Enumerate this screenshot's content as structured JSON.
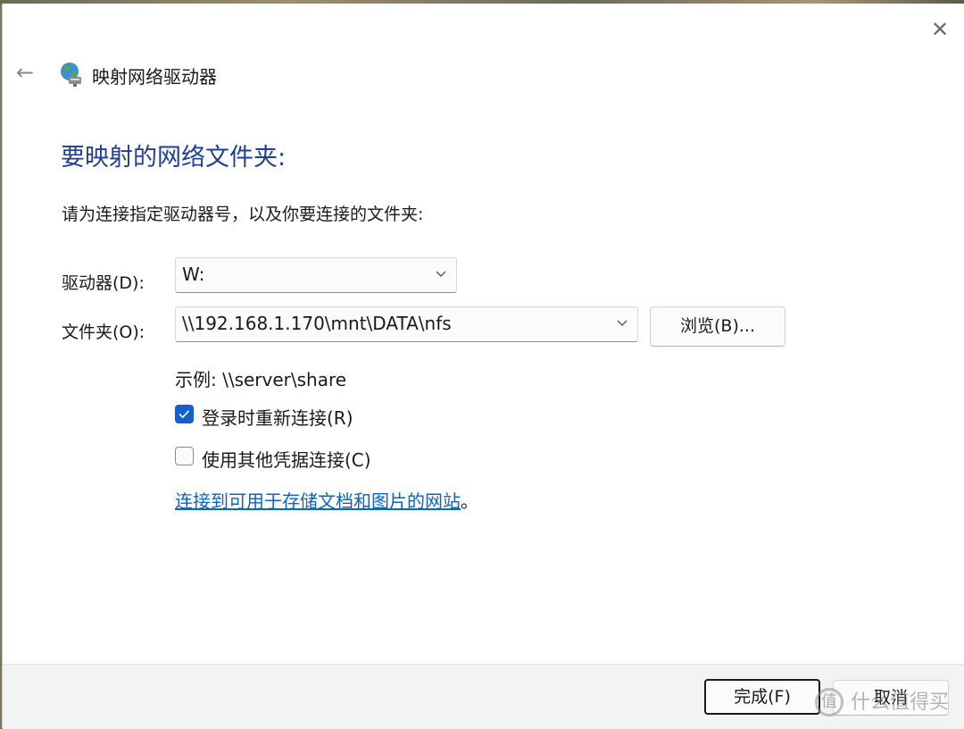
{
  "window": {
    "title": "映射网络驱动器",
    "close_glyph": "✕",
    "back_glyph": "←"
  },
  "main": {
    "heading": "要映射的网络文件夹:",
    "description": "请为连接指定驱动器号，以及你要连接的文件夹:",
    "drive": {
      "label": "驱动器(D):",
      "value": "W:"
    },
    "folder": {
      "label": "文件夹(O):",
      "value": "\\\\192.168.1.170\\mnt\\DATA\\nfs"
    },
    "browse_label": "浏览(B)...",
    "example": "示例: \\\\server\\share",
    "reconnect": {
      "label": "登录时重新连接(R)",
      "checked": true
    },
    "other_credentials": {
      "label": "使用其他凭据连接(C)",
      "checked": false
    },
    "link": {
      "text": "连接到可用于存储文档和图片的网站",
      "suffix": "。"
    }
  },
  "footer": {
    "finish_label": "完成(F)",
    "cancel_label": "取消"
  },
  "watermark": {
    "glyph": "值",
    "text": "什么值得买"
  },
  "colors": {
    "heading": "#1f3f94",
    "accent": "#1360c8",
    "link": "#0b63c2"
  },
  "icons": {
    "app": "network-drive-icon",
    "back": "back-arrow-icon",
    "close": "close-icon",
    "dropdown": "chevron-down-icon",
    "check": "checkmark-icon"
  }
}
